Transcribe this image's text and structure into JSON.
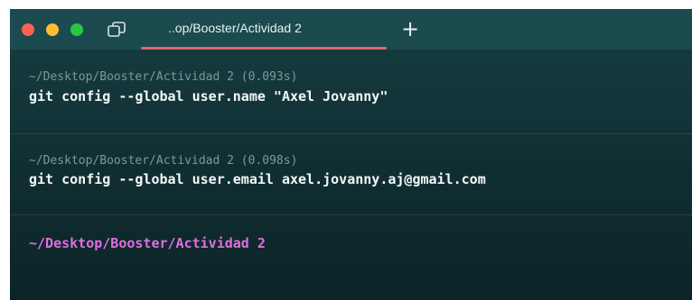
{
  "colors": {
    "close": "#ff5f57",
    "minimize": "#febc2e",
    "maximize": "#28c840",
    "tab_underline": "#e0676a",
    "prompt": "#e06ee0"
  },
  "titlebar": {
    "tab_title": "..op/Booster/Actividad 2",
    "new_tab_label": "+",
    "tabs_icon": "tabs-icon"
  },
  "blocks": [
    {
      "meta": "~/Desktop/Booster/Actividad 2 (0.093s)",
      "command": "git config --global user.name \"Axel Jovanny\""
    },
    {
      "meta": "~/Desktop/Booster/Actividad 2 (0.098s)",
      "command": "git config --global user.email axel.jovanny.aj@gmail.com"
    }
  ],
  "prompt": {
    "path": "~/Desktop/Booster/Actividad 2"
  }
}
